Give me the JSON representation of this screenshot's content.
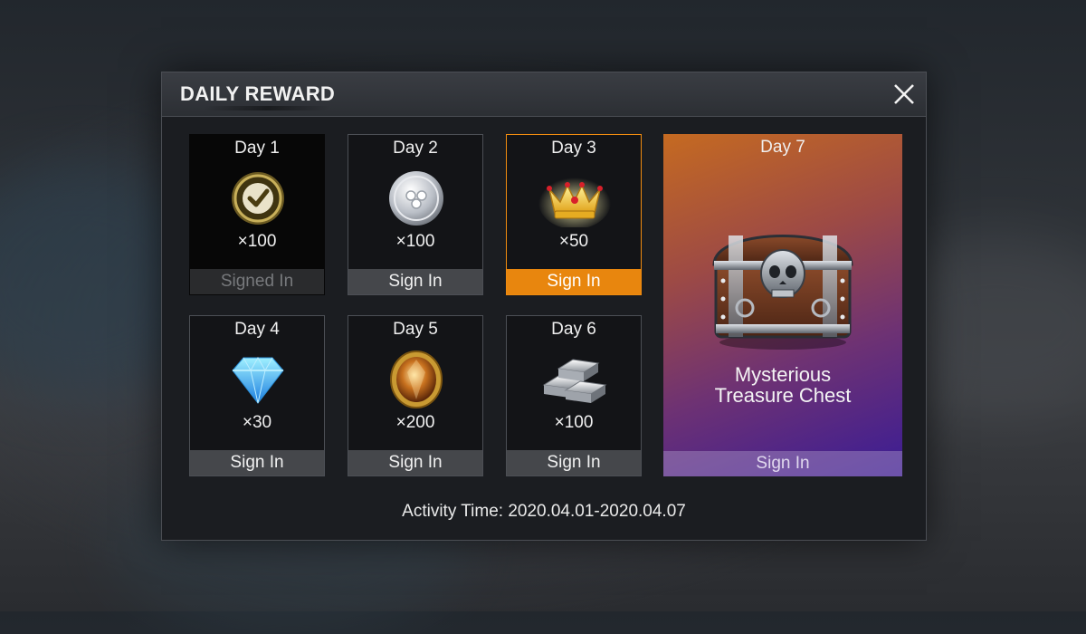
{
  "header": {
    "title": "DAILY REWARD"
  },
  "days": [
    {
      "day": "Day 1",
      "qty": "×100",
      "button": "Signed In",
      "icon": "check-coin-icon",
      "state": "claimed"
    },
    {
      "day": "Day 2",
      "qty": "×100",
      "button": "Sign In",
      "icon": "silver-coin-icon",
      "state": "available"
    },
    {
      "day": "Day 3",
      "qty": "×50",
      "button": "Sign In",
      "icon": "crown-icon",
      "state": "active"
    },
    {
      "day": "Day 4",
      "qty": "×30",
      "button": "Sign In",
      "icon": "diamond-icon",
      "state": "available"
    },
    {
      "day": "Day 5",
      "qty": "×200",
      "button": "Sign In",
      "icon": "amber-gem-icon",
      "state": "available"
    },
    {
      "day": "Day 6",
      "qty": "×100",
      "button": "Sign In",
      "icon": "silver-bars-icon",
      "state": "available"
    }
  ],
  "day7": {
    "day": "Day 7",
    "name_line1": "Mysterious",
    "name_line2": "Treasure Chest",
    "button": "Sign In",
    "icon": "treasure-chest-icon"
  },
  "activity_time": "Activity Time: 2020.04.01-2020.04.07",
  "colors": {
    "accent": "#e8860e",
    "card_bg": "#131417",
    "button_bg": "#45474b"
  }
}
